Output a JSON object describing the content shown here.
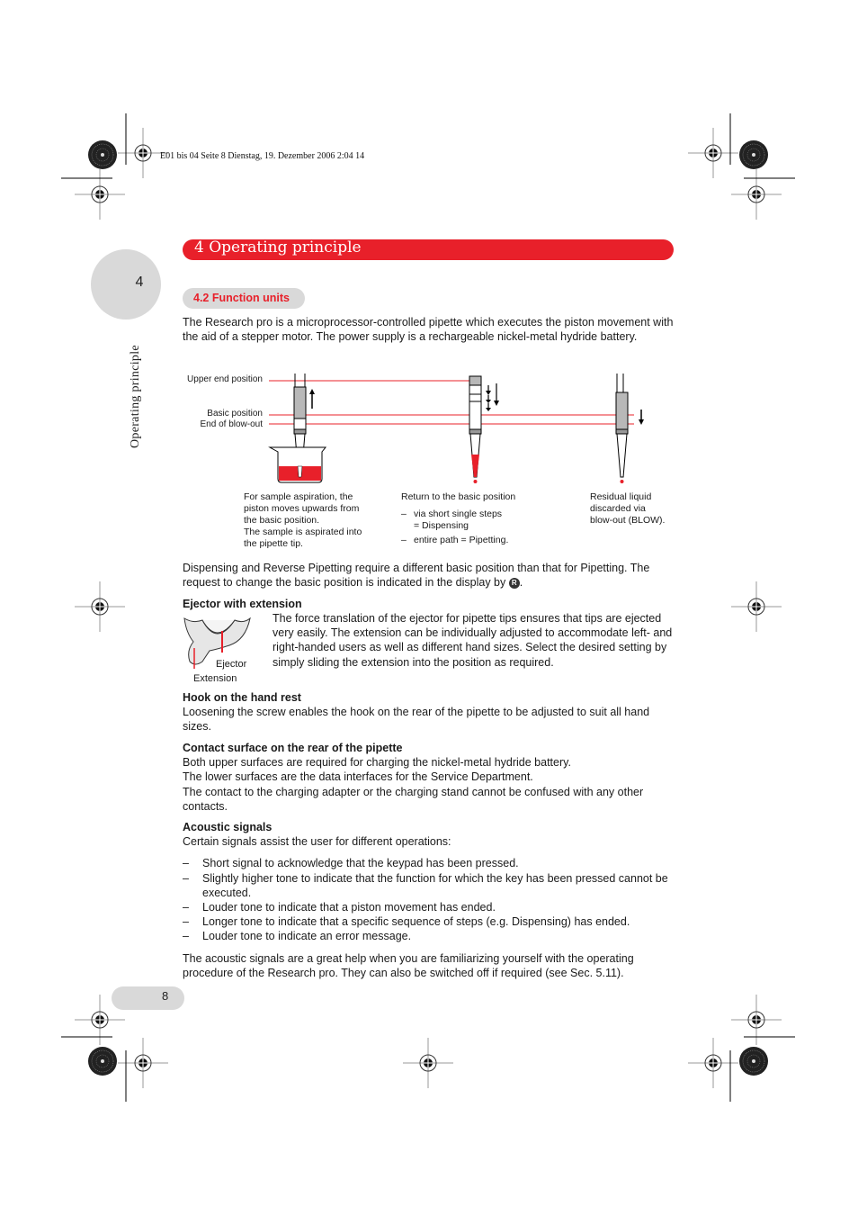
{
  "print_header": "E01 bis 04  Seite 8  Dienstag, 19. Dezember 2006  2:04 14",
  "chapter": {
    "number": "4",
    "title": "4  Operating principle",
    "tab_number": "4",
    "side_title": "Operating principle",
    "accent_color": "#e8202a"
  },
  "section": {
    "label": "4.2  Function units"
  },
  "intro": "The Research pro is a microprocessor-controlled pipette which executes the piston movement with the aid of a stepper motor. The power supply is a rechargeable nickel-metal hydride battery.",
  "diagram": {
    "labels": {
      "upper_end": "Upper end position",
      "basic": "Basic position",
      "blow_out": "End of blow-out"
    },
    "captions": {
      "aspiration": [
        "For sample aspiration, the",
        "piston moves upwards from",
        "the basic position.",
        "The sample is aspirated into",
        "the pipette tip."
      ],
      "return_title": "Return to the basic position",
      "return_items": [
        {
          "dash": "–",
          "lines": [
            "via short single steps",
            "= Dispensing"
          ]
        },
        {
          "dash": "–",
          "lines": [
            "entire path = Pipetting."
          ]
        }
      ],
      "blowout": [
        "Residual liquid",
        "discarded via",
        "blow-out (BLOW)."
      ]
    }
  },
  "dispensing_note": {
    "text": "Dispensing and Reverse Pipetting require a different basic position than that for Pipetting. The request to change the basic position is indicated in the display by",
    "badge": "R",
    "end": "."
  },
  "ejector": {
    "heading": "Ejector with extension",
    "text": "The force translation of the ejector for pipette tips ensures that tips are ejected very easily. The extension can be individually adjusted to accommodate left- and right-handed users as well as different hand sizes. Select the desired setting by simply sliding the extension into the position as required.",
    "label_ejector": "Ejector",
    "label_extension": "Extension"
  },
  "hook": {
    "heading": "Hook on the hand rest",
    "text": "Loosening the screw enables the hook on the rear of the pipette to be adjusted to suit all hand sizes."
  },
  "contact": {
    "heading": "Contact surface on the rear of the pipette",
    "lines": [
      "Both upper surfaces are required for charging the nickel-metal hydride battery.",
      "The lower surfaces are the data interfaces for the Service Department.",
      "The contact to the charging adapter or the charging stand cannot be confused with any other contacts."
    ]
  },
  "acoustic": {
    "heading": "Acoustic signals",
    "intro": "Certain signals assist the user for different operations:",
    "items": [
      "Short signal to acknowledge that the keypad has been pressed.",
      "Slightly higher tone to indicate that the function for which the key has been pressed cannot be executed.",
      "Louder tone to indicate that a piston movement has ended.",
      "Longer tone to indicate that a specific sequence of steps (e.g. Dispensing) has ended.",
      "Louder tone to indicate an error message."
    ],
    "dash": "–",
    "closing": "The acoustic signals are a great help when you are familiarizing yourself with the operating procedure of the Research pro. They can also be switched off if required (see Sec. 5.11)."
  },
  "page_number": "8"
}
